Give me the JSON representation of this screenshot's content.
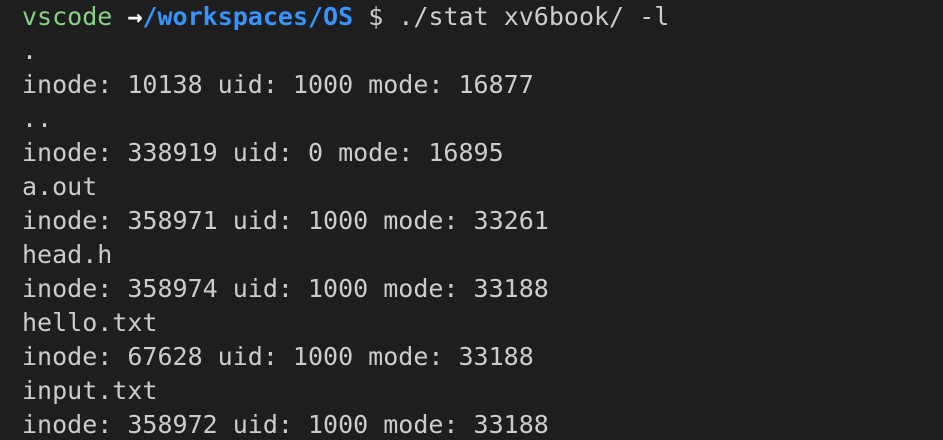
{
  "terminal": {
    "prompt": {
      "user": "vscode",
      "arrow": "→",
      "path": "/workspaces/OS",
      "symbol": "$",
      "command": "./stat xv6book/ -l"
    },
    "output_lines": [
      ".",
      "inode: 10138 uid: 1000 mode: 16877",
      "..",
      "inode: 338919 uid: 0 mode: 16895",
      "a.out",
      "inode: 358971 uid: 1000 mode: 33261",
      "head.h",
      "inode: 358974 uid: 1000 mode: 33188",
      "hello.txt",
      "inode: 67628 uid: 1000 mode: 33188",
      "input.txt",
      "inode: 358972 uid: 1000 mode: 33188"
    ]
  },
  "colors": {
    "background": "#1e1e1e",
    "text": "#cccccc",
    "user": "#89d185",
    "path": "#3794ff"
  }
}
